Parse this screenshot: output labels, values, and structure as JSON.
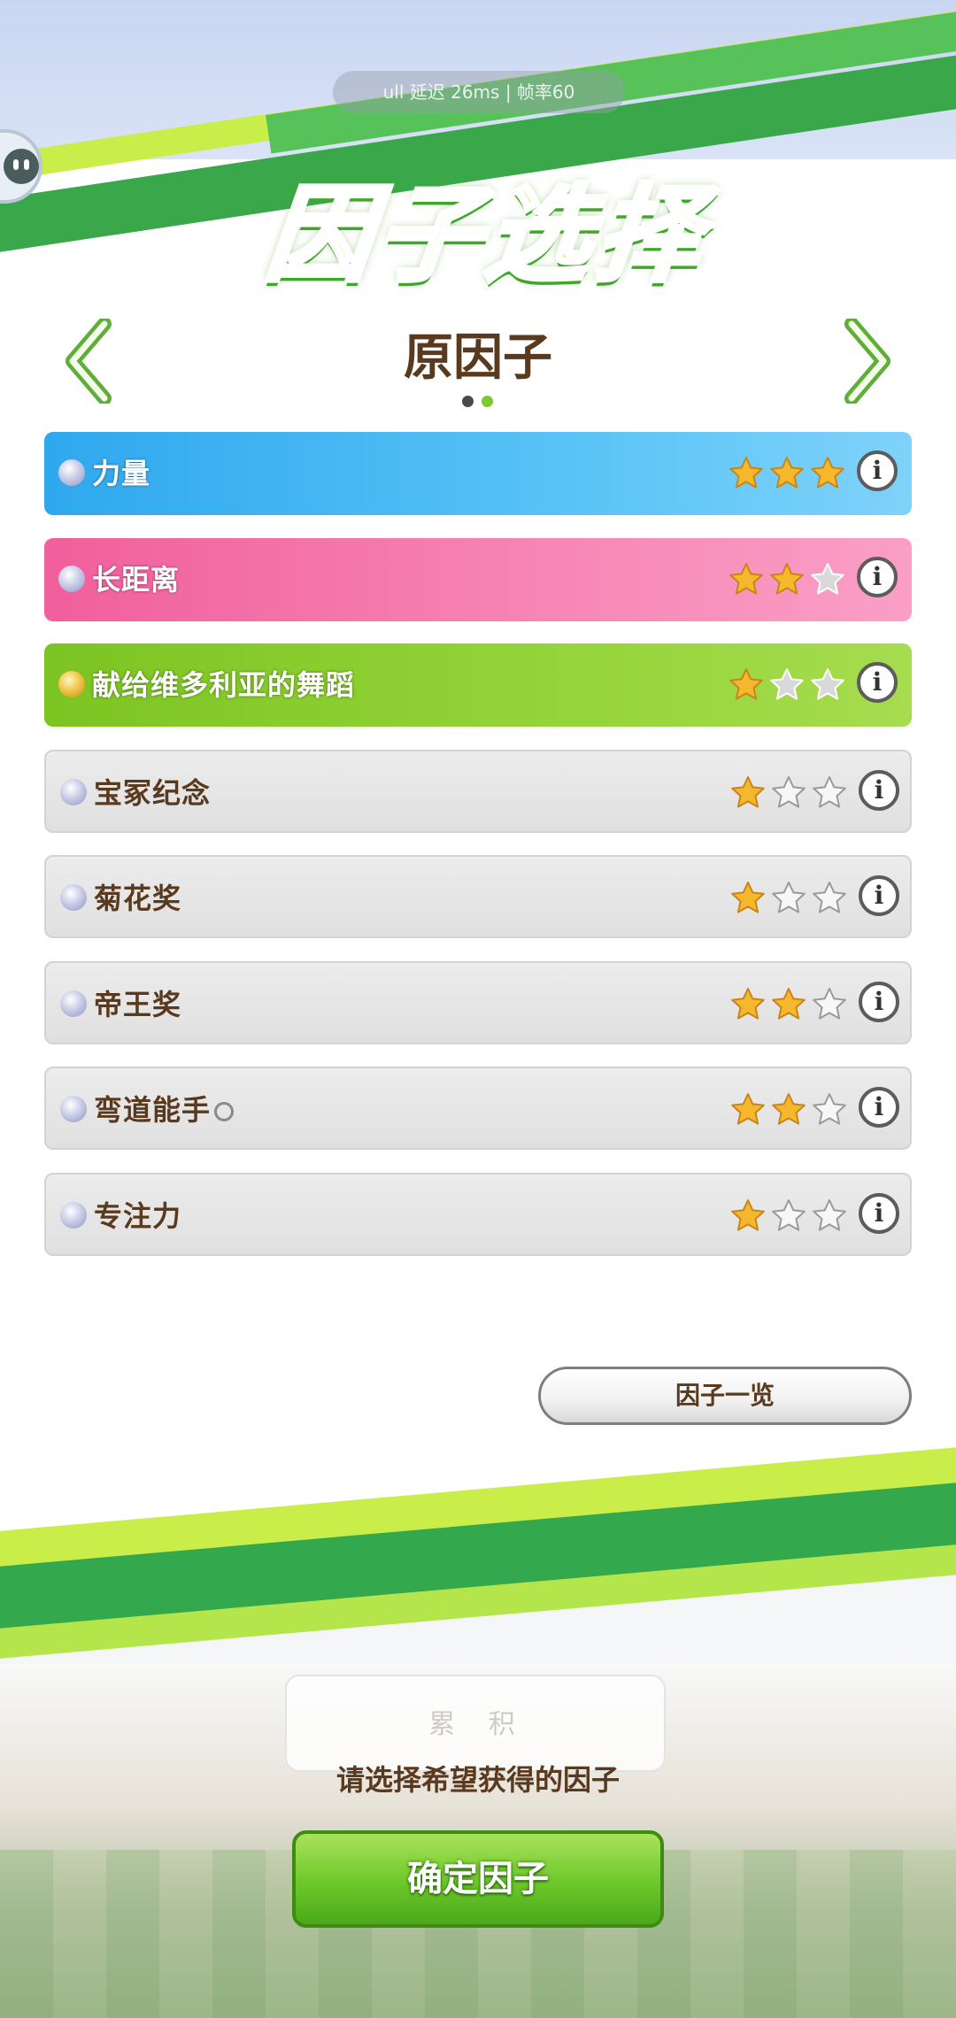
{
  "status_bar": {
    "text": "ull 延迟 26ms | 帧率60"
  },
  "header": {
    "title": "因子选择",
    "subtitle": "原因子",
    "page_indicator": {
      "count": 2,
      "active_index": 1
    }
  },
  "colors": {
    "blue": "#3db3f0",
    "pink": "#f36fa6",
    "green": "#8ccf2e",
    "gray": "#e1e1e1",
    "star_filled": "#f5b82c",
    "brown_text": "#5a3a1e"
  },
  "factors": [
    {
      "label": "力量",
      "color": "blue",
      "bullet": "silver",
      "rating": 3,
      "style": "filled-gray"
    },
    {
      "label": "长距离",
      "color": "pink",
      "bullet": "silver",
      "rating": 2,
      "style": "filled-gray"
    },
    {
      "label": "献给维多利亚的舞蹈",
      "color": "green",
      "bullet": "gold",
      "rating": 1,
      "style": "filled-gray"
    },
    {
      "label": "宝冢纪念",
      "color": "gray",
      "bullet": "silver",
      "rating": 1,
      "style": "outline"
    },
    {
      "label": "菊花奖",
      "color": "gray",
      "bullet": "silver",
      "rating": 1,
      "style": "outline"
    },
    {
      "label": "帝王奖",
      "color": "gray",
      "bullet": "silver",
      "rating": 2,
      "style": "outline"
    },
    {
      "label": "弯道能手",
      "color": "gray",
      "bullet": "silver",
      "rating": 2,
      "style": "outline",
      "suffix_icon": "circle-icon"
    },
    {
      "label": "专注力",
      "color": "gray",
      "bullet": "silver",
      "rating": 1,
      "style": "outline"
    }
  ],
  "buttons": {
    "factor_list": "因子一览",
    "confirm": "确定因子"
  },
  "footer": {
    "blurred_card_label": "累 积",
    "hint": "请选择希望获得的因子"
  },
  "icons": {
    "prev": "chevron-left-icon",
    "next": "chevron-right-icon",
    "info": "info-icon",
    "star": "star-icon"
  }
}
